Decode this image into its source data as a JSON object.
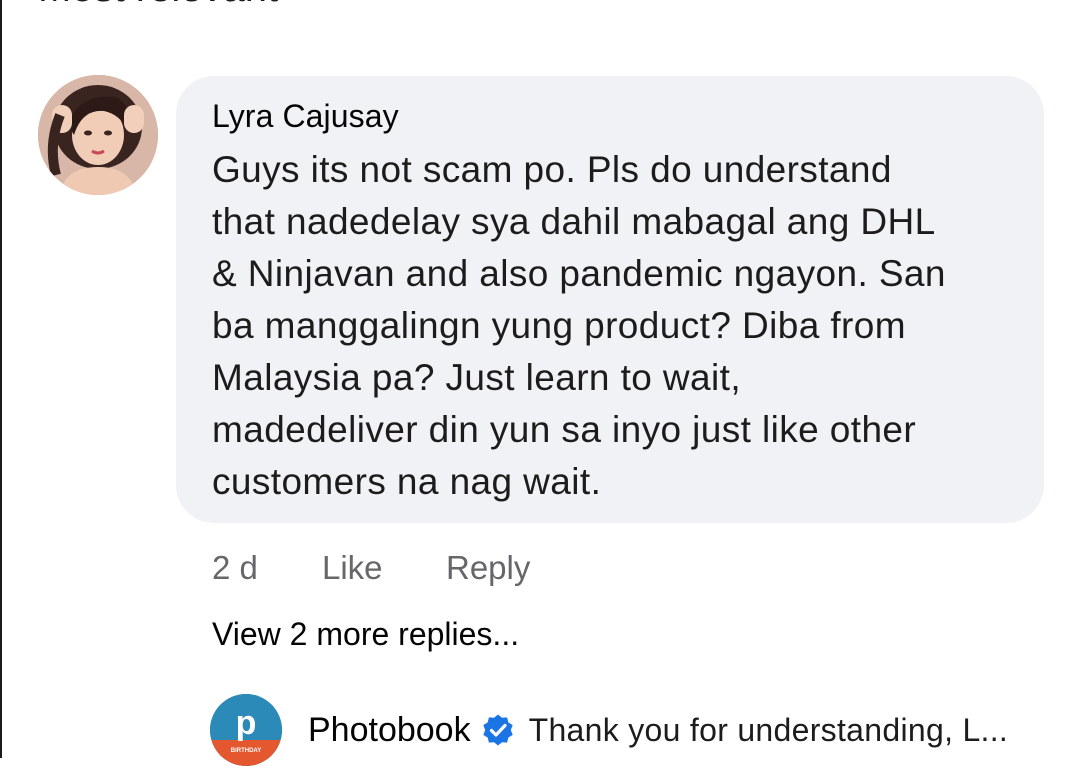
{
  "section_heading": "Most relevant",
  "comment": {
    "author": "Lyra Cajusay",
    "lines": [
      "Guys its not scam po. Pls do understand",
      "that nadedelay sya dahil mabagal ang DHL",
      "& Ninjavan and also pandemic ngayon. San",
      "ba manggalingn yung product? Diba from",
      "Malaysia pa? Just learn to wait,",
      "madedeliver din yun sa inyo just like other",
      "customers na nag wait."
    ],
    "time": "2 d",
    "like_label": "Like",
    "reply_label": "Reply"
  },
  "view_more_replies": "View 2 more replies...",
  "reply_preview": {
    "author": "Photobook",
    "avatar_letter": "p",
    "avatar_banner": "BIRTHDAY",
    "verified": true,
    "text": "Thank you for understanding, L..."
  },
  "colors": {
    "bubble_bg": "#f0f2f5",
    "meta_text": "#65676b",
    "verified_blue": "#1b74e4"
  },
  "icons": {
    "verified": "verified-check-icon"
  }
}
